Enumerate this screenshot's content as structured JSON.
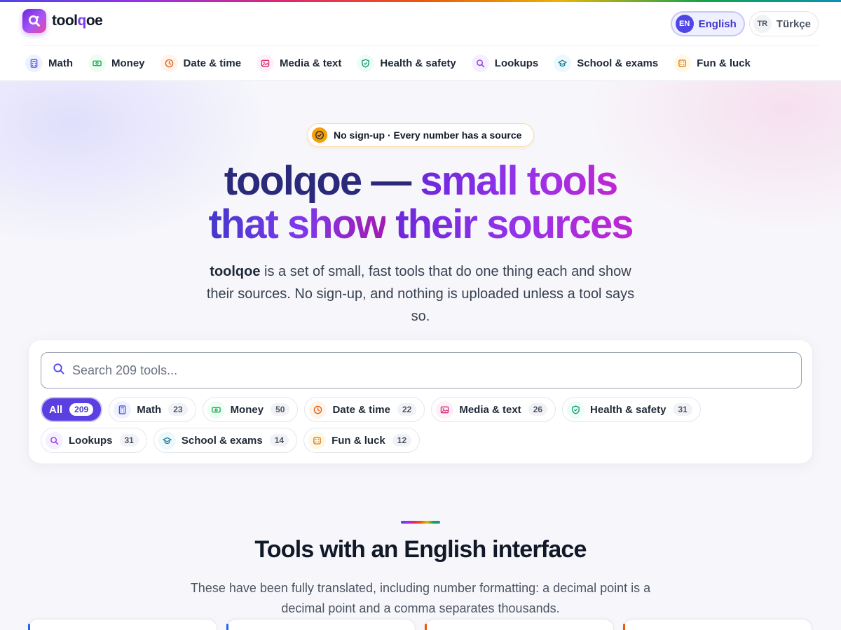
{
  "brand": {
    "name_prefix": "tool",
    "name_q": "q",
    "name_suffix": "oe"
  },
  "languages": [
    {
      "code": "EN",
      "label": "English",
      "active": true
    },
    {
      "code": "TR",
      "label": "Türkçe",
      "active": false
    }
  ],
  "nav": {
    "categories": [
      {
        "label": "Math",
        "icon": "calculator-icon"
      },
      {
        "label": "Money",
        "icon": "banknote-icon"
      },
      {
        "label": "Date & time",
        "icon": "clock-icon"
      },
      {
        "label": "Media & text",
        "icon": "image-icon"
      },
      {
        "label": "Health & safety",
        "icon": "shield-icon"
      },
      {
        "label": "Lookups",
        "icon": "search-icon"
      },
      {
        "label": "School & exams",
        "icon": "graduation-cap-icon"
      },
      {
        "label": "Fun & luck",
        "icon": "dice-icon"
      }
    ]
  },
  "hero": {
    "badge": "No sign-up · Every number has a source",
    "title_line1_dark": "toolqoe —",
    "title_line1_grad": "small tools",
    "title_line2_dark": "that show",
    "title_line2_grad": "their sources",
    "desc_brand": "toolqoe",
    "desc_rest": " is a set of small, fast tools that do one thing each and show their sources. No sign-up, and nothing is uploaded unless a tool says so."
  },
  "search": {
    "placeholder": "Search 209 tools...",
    "value": "",
    "filters": [
      {
        "label": "All",
        "count": "209",
        "active": true
      },
      {
        "label": "Math",
        "count": "23"
      },
      {
        "label": "Money",
        "count": "50"
      },
      {
        "label": "Date & time",
        "count": "22"
      },
      {
        "label": "Media & text",
        "count": "26"
      },
      {
        "label": "Health & safety",
        "count": "31"
      },
      {
        "label": "Lookups",
        "count": "31"
      },
      {
        "label": "School & exams",
        "count": "14"
      },
      {
        "label": "Fun & luck",
        "count": "12"
      }
    ]
  },
  "section": {
    "title": "Tools with an English interface",
    "desc": "These have been fully translated, including number formatting: a decimal point is a decimal point and a comma separates thousands."
  },
  "colors": {
    "accent": "#5b3fe0",
    "title_dark": "#2b2a7a",
    "badge_border": "#fcd9a8"
  }
}
